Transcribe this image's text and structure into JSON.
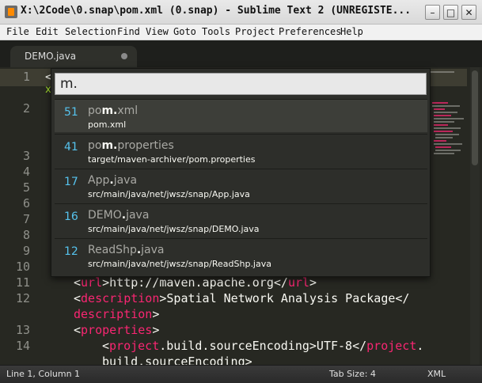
{
  "window": {
    "title": "X:\\2Code\\0.snap\\pom.xml (0.snap) - Sublime Text 2 (UNREGISTE...",
    "min_label": "–",
    "max_label": "□",
    "close_label": "✕"
  },
  "menu": {
    "items": [
      "File",
      "Edit",
      "Selection",
      "Find",
      "View",
      "Goto",
      "Tools",
      "Project",
      "Preferences",
      "Help"
    ]
  },
  "tab": {
    "label": "DEMO.java"
  },
  "editor": {
    "line1_fragment": "<",
    "line1_subfragment": "x",
    "line_numbers": [
      "1",
      "2",
      "3",
      "4",
      "5",
      "6",
      "7",
      "8",
      "9",
      "10",
      "11",
      "12",
      "13",
      "14"
    ],
    "code": {
      "l11": {
        "open": "<",
        "tag1": "url",
        "mid": ">http://maven.apache.org</",
        "tag2": "url",
        "close": ">"
      },
      "l12": {
        "open": "<",
        "tag1": "description",
        "mid": ">Spatial Network Analysis Package</"
      },
      "l12b": {
        "tag2": "description",
        "close": ">"
      },
      "l13": {
        "open": "<",
        "tag1": "properties",
        "close": ">"
      },
      "l14": {
        "open": "<",
        "tag1": "project",
        "mid": ".build.sourceEncoding>UTF-8</",
        "tag2": "project",
        "close": "."
      },
      "l14b": {
        "text": "build.sourceEncoding>"
      }
    }
  },
  "goto": {
    "query": "m.",
    "results": [
      {
        "score": "51",
        "name_pre": "po",
        "name_bold": "m.",
        "name_post": "xml",
        "path": "pom.xml"
      },
      {
        "score": "41",
        "name_pre": "po",
        "name_bold": "m.",
        "name_post": "properties",
        "path": "target/maven-archiver/pom.properties"
      },
      {
        "score": "17",
        "name_pre": "App",
        "name_bold": ".",
        "name_post": "java",
        "path": "src/main/java/net/jwsz/snap/App.java"
      },
      {
        "score": "16",
        "name_pre": "DEMO",
        "name_bold": ".",
        "name_post": "java",
        "path": "src/main/java/net/jwsz/snap/DEMO.java"
      },
      {
        "score": "12",
        "name_pre": "ReadShp",
        "name_bold": ".",
        "name_post": "java",
        "path": "src/main/java/net/jwsz/snap/ReadShp.java"
      }
    ]
  },
  "status": {
    "position": "Line 1, Column 1",
    "tab_size": "Tab Size: 4",
    "syntax": "XML"
  },
  "colors": {
    "background": "#272822",
    "tag": "#f92672",
    "score": "#56c3ee",
    "accent_green": "#a6e22e"
  }
}
